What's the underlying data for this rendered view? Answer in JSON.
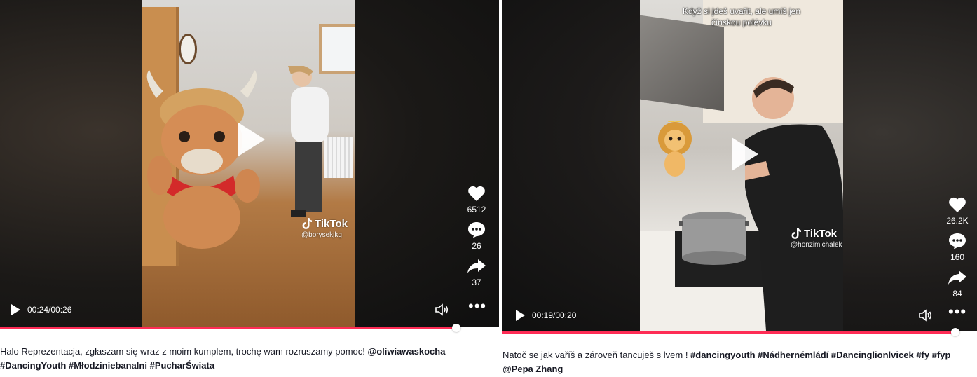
{
  "posts": [
    {
      "time": "00:24/00:26",
      "progress": 0.915,
      "likes": "6512",
      "comments": "26",
      "shares": "37",
      "watermark": {
        "brand": "TikTok",
        "handle": "@borysekjkg"
      },
      "overlay_text": "",
      "description": {
        "text": "Halo Reprezentacja, zgłaszam się wraz z moim kumplem, trochę wam rozruszamy pomoc! ",
        "tags": [
          "@oliwiawaskocha",
          "#DancingYouth",
          "#Młodziniebanalni",
          "#PucharŚwiata"
        ]
      }
    },
    {
      "time": "00:19/00:20",
      "progress": 0.955,
      "likes": "26.2K",
      "comments": "160",
      "shares": "84",
      "watermark": {
        "brand": "TikTok",
        "handle": "@honzimichalek"
      },
      "overlay_text": "Když si jdeš uvařit, ale umíš jen čínskou polévku",
      "description": {
        "text": "Natoč se jak vaříš a zároveň tancuješ s lvem ! ",
        "tags": [
          "#dancingyouth",
          "#Nádhernémládí",
          "#Dancinglionlvicek",
          "#fy",
          "#fyp",
          "@Pepa Zhang"
        ]
      }
    }
  ],
  "colors": {
    "accent": "#fe2c55",
    "text": "#161823",
    "player_bg": "#151515"
  },
  "icons": [
    "play-icon",
    "heart-icon",
    "comment-icon",
    "share-icon",
    "volume-icon",
    "more-icon",
    "tiktok-logo-icon"
  ]
}
